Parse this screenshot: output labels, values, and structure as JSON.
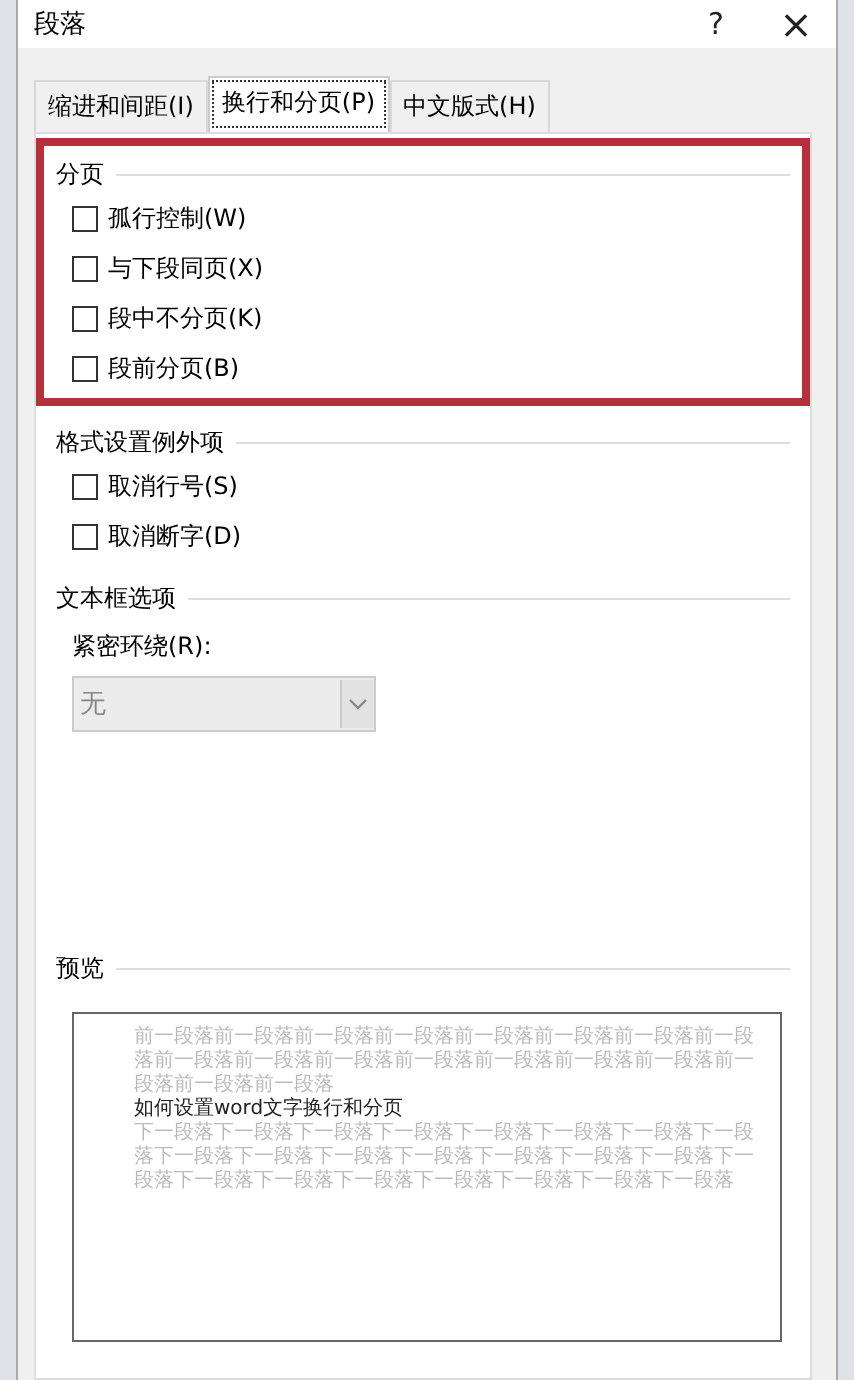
{
  "window": {
    "title": "段落",
    "help": "?",
    "close": "×"
  },
  "tabs": [
    {
      "label": "缩进和间距(I)",
      "selected": false
    },
    {
      "label": "换行和分页(P)",
      "selected": true
    },
    {
      "label": "中文版式(H)",
      "selected": false
    }
  ],
  "sections": [
    {
      "title": "分页",
      "highlighted": true,
      "checkboxes": [
        {
          "label": "孤行控制(W)",
          "checked": false
        },
        {
          "label": "与下段同页(X)",
          "checked": false
        },
        {
          "label": "段中不分页(K)",
          "checked": false
        },
        {
          "label": "段前分页(B)",
          "checked": false
        }
      ]
    },
    {
      "title": "格式设置例外项",
      "highlighted": false,
      "checkboxes": [
        {
          "label": "取消行号(S)",
          "checked": false
        },
        {
          "label": "取消断字(D)",
          "checked": false
        }
      ]
    },
    {
      "title": "文本框选项",
      "highlighted": false,
      "dropdown": {
        "label": "紧密环绕(R):",
        "value": "无",
        "disabled": true
      }
    }
  ],
  "preview": {
    "title": "预览",
    "previous_text": "前一段落前一段落前一段落前一段落前一段落前一段落前一段落前一段落前一段落前一段落前一段落前一段落前一段落前一段落前一段落前一段落前一段落前一段落",
    "current_text": "如何设置word文字换行和分页",
    "next_text": "下一段落下一段落下一段落下一段落下一段落下一段落下一段落下一段落下一段落下一段落下一段落下一段落下一段落下一段落下一段落下一段落下一段落下一段落下一段落下一段落下一段落下一段落下一段落"
  }
}
